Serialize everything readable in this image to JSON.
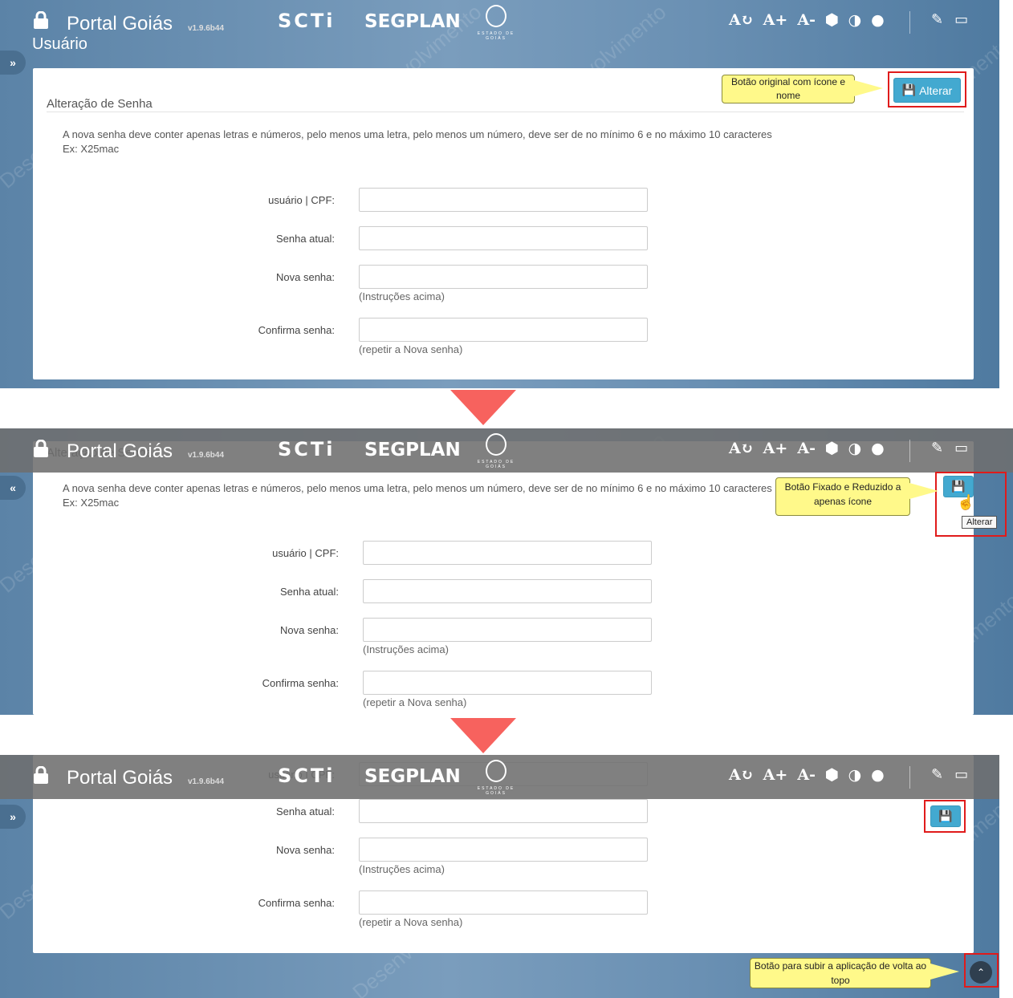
{
  "app": {
    "title": "Portal Goiás",
    "version": "v1.9.6b44",
    "logo_scti": "SCTi",
    "logo_segplan": "SEGPLAN",
    "seal_caption": "ESTADO DE GOIÁS"
  },
  "accessibility": {
    "reset_font": "A↻",
    "increase_font": "A+",
    "decrease_font": "A-"
  },
  "page": {
    "title": "Usuário",
    "section_title": "Alteração de Senha",
    "description_line1": "A nova senha deve conter apenas letras e números, pelo menos uma letra, pelo menos um número, deve ser de no mínimo 6 e no máximo 10 caracteres",
    "description_line2": "Ex: X25mac"
  },
  "form": {
    "user_label": "usuário | CPF:",
    "current_password_label": "Senha atual:",
    "new_password_label": "Nova senha:",
    "new_password_help": "(Instruções acima)",
    "confirm_label": "Confirma senha:",
    "confirm_help": "(repetir a Nova senha)"
  },
  "buttons": {
    "alterar_label": "Alterar",
    "tooltip": "Alterar"
  },
  "callouts": {
    "original_button": "Botão original com ícone e nome",
    "fixed_button": "Botão Fixado e Reduzido a apenas ícone",
    "back_to_top": "Botão para subir a aplicação de volta ao topo"
  },
  "watermark": "Desenvolvimento",
  "colors": {
    "accent_button": "#43a9d0",
    "highlight_box": "#e01b1b",
    "callout_bg": "#fff98a",
    "transition_arrow": "#f7625e"
  }
}
